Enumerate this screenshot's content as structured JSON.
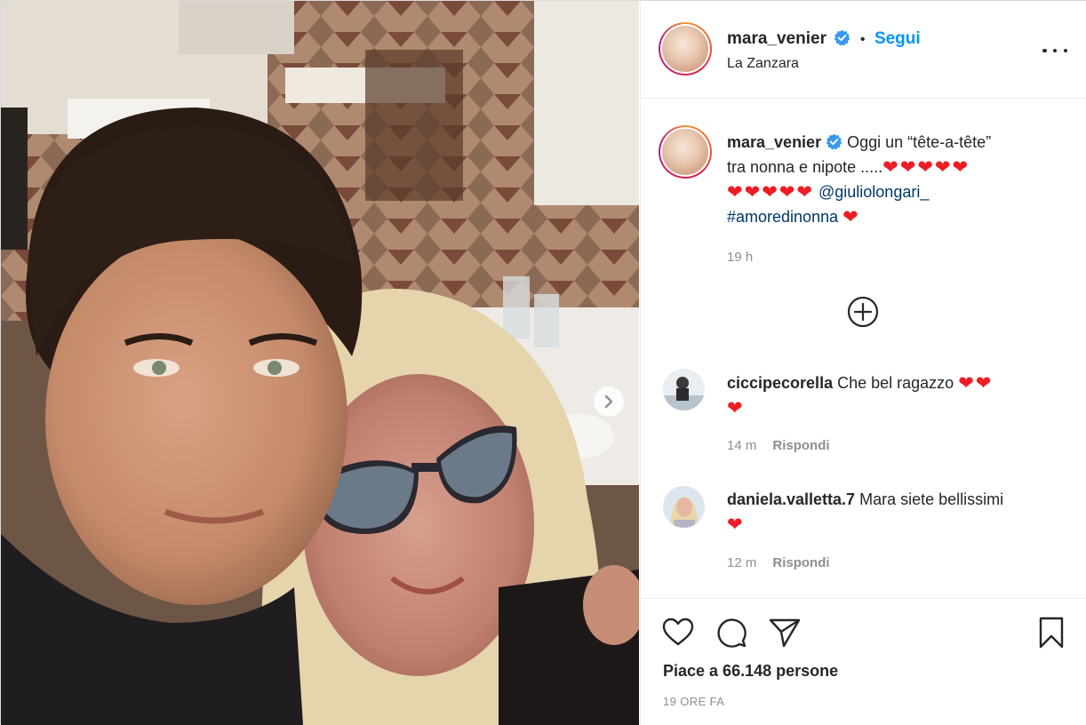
{
  "post": {
    "username": "mara_venier",
    "follow_label": "Segui",
    "separator": "•",
    "location": "La Zanzara",
    "caption": {
      "username": "mara_venier",
      "line1_text": "Oggi un “tête-a-tête”",
      "line2_text": "tra nonna e nipote .....",
      "line2_hearts": "❤❤❤❤❤",
      "line3_hearts": "❤❤❤❤❤",
      "mention": "@giuliolongari_",
      "hashtag": "#amoredinonna",
      "line4_hearts": "❤",
      "time": "19 h"
    },
    "comments": [
      {
        "username": "ciccipecorella",
        "text": "Che bel ragazzo",
        "hearts_inline": "❤❤",
        "hearts_next": "❤",
        "time": "14 m",
        "reply_label": "Rispondi"
      },
      {
        "username": "daniela.valletta.7",
        "text": "Mara siete bellissimi",
        "hearts_inline": "",
        "hearts_next": "❤",
        "time": "12 m",
        "reply_label": "Rispondi"
      }
    ],
    "likes_text": "Piace a 66.148 persone",
    "date_text": "19 ORE FA"
  },
  "icons": {
    "verified": "verified-badge-icon",
    "more": "more-options-icon",
    "load_more": "plus-circle-icon",
    "like": "heart-icon",
    "comment": "comment-icon",
    "share": "paper-plane-icon",
    "save": "bookmark-icon",
    "next": "chevron-right-icon"
  },
  "colors": {
    "accent": "#0095f6",
    "text": "#262626",
    "muted": "#8e8e8e",
    "heart": "#ed1c24",
    "link": "#00376b"
  }
}
